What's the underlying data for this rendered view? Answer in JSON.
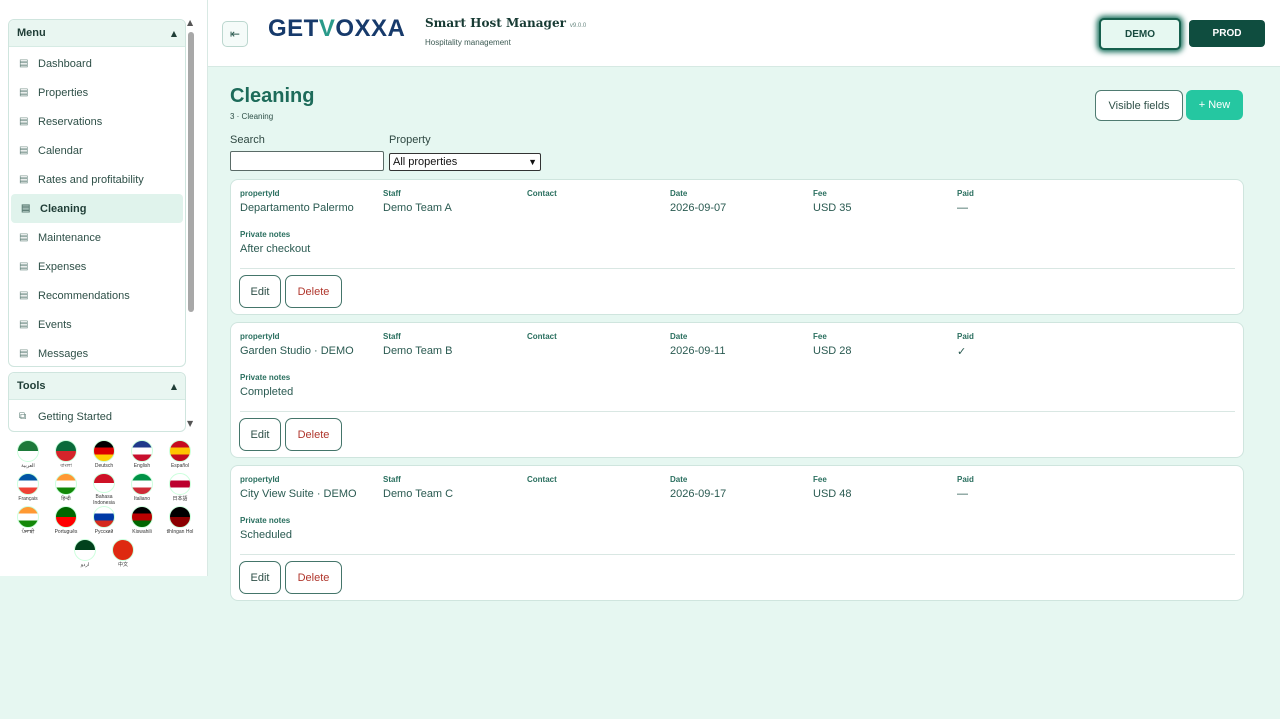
{
  "sidebar": {
    "menu_title": "Menu",
    "menu_items": [
      {
        "label": "Dashboard"
      },
      {
        "label": "Properties"
      },
      {
        "label": "Reservations"
      },
      {
        "label": "Calendar"
      },
      {
        "label": "Rates and profitability"
      },
      {
        "label": "Cleaning",
        "active": true
      },
      {
        "label": "Maintenance"
      },
      {
        "label": "Expenses"
      },
      {
        "label": "Recommendations"
      },
      {
        "label": "Events"
      },
      {
        "label": "Messages"
      }
    ],
    "tools_title": "Tools",
    "tools_items": [
      {
        "label": "Getting Started"
      }
    ],
    "languages": [
      {
        "label": "العربية",
        "colors": [
          "#1d7a3a",
          "#ffffff"
        ]
      },
      {
        "label": "বাংলা",
        "colors": [
          "#0a6b3a",
          "#d6242b"
        ]
      },
      {
        "label": "Deutsch",
        "colors": [
          "#000000",
          "#dd0000",
          "#ffce00"
        ]
      },
      {
        "label": "English",
        "colors": [
          "#1f3a8a",
          "#ffffff",
          "#c8102e"
        ]
      },
      {
        "label": "Español",
        "colors": [
          "#c60b1e",
          "#ffc400",
          "#c60b1e"
        ]
      },
      {
        "label": "Français",
        "colors": [
          "#0055a4",
          "#ffffff",
          "#ef4135"
        ]
      },
      {
        "label": "हिन्दी",
        "colors": [
          "#ff9933",
          "#ffffff",
          "#138808"
        ]
      },
      {
        "label": "Bahasa Indonesia",
        "colors": [
          "#ce1126",
          "#ffffff"
        ]
      },
      {
        "label": "Italiano",
        "colors": [
          "#009246",
          "#ffffff",
          "#ce2b37"
        ]
      },
      {
        "label": "日本語",
        "colors": [
          "#ffffff",
          "#bc002d",
          "#ffffff"
        ]
      },
      {
        "label": "ਪੰਜਾਬੀ",
        "colors": [
          "#ff9933",
          "#ffffff",
          "#138808"
        ]
      },
      {
        "label": "Português",
        "colors": [
          "#006600",
          "#ff0000"
        ]
      },
      {
        "label": "Русский",
        "colors": [
          "#ffffff",
          "#0039a6",
          "#d52b1e"
        ]
      },
      {
        "label": "Kiswahili",
        "colors": [
          "#000000",
          "#bb0000",
          "#006600"
        ]
      },
      {
        "label": "tlhIngan Hol",
        "colors": [
          "#000000",
          "#8b0000"
        ]
      },
      {
        "label": "اردو",
        "colors": [
          "#01411c",
          "#ffffff"
        ]
      },
      {
        "label": "中文",
        "colors": [
          "#de2910",
          "#de2910"
        ]
      }
    ]
  },
  "header": {
    "logo_left": "GET",
    "logo_v": "V",
    "logo_right": "OXXA",
    "app_title": "Smart Host Manager",
    "app_version": "v9.0.0",
    "app_subtitle": "Hospitality management",
    "demo_label": "DEMO",
    "prod_label": "PROD"
  },
  "main": {
    "title": "Cleaning",
    "breadcrumb": "3 · Cleaning",
    "visible_fields_label": "Visible fields",
    "new_label": "+ New",
    "search_label": "Search",
    "search_value": "",
    "property_label": "Property",
    "property_selected": "All properties",
    "field_labels": {
      "property": "propertyId",
      "staff": "Staff",
      "contact": "Contact",
      "date": "Date",
      "fee": "Fee",
      "paid": "Paid",
      "notes": "Private notes"
    },
    "edit_label": "Edit",
    "delete_label": "Delete",
    "cards": [
      {
        "property": "Departamento Palermo",
        "staff": "Demo Team A",
        "contact": "",
        "date": "2026-09-07",
        "fee": "USD 35",
        "paid": "—",
        "notes": "After checkout"
      },
      {
        "property": "Garden Studio · DEMO",
        "staff": "Demo Team B",
        "contact": "",
        "date": "2026-09-11",
        "fee": "USD 28",
        "paid": "✓",
        "notes": "Completed"
      },
      {
        "property": "City View Suite · DEMO",
        "staff": "Demo Team C",
        "contact": "",
        "date": "2026-09-17",
        "fee": "USD 48",
        "paid": "—",
        "notes": "Scheduled"
      }
    ]
  }
}
